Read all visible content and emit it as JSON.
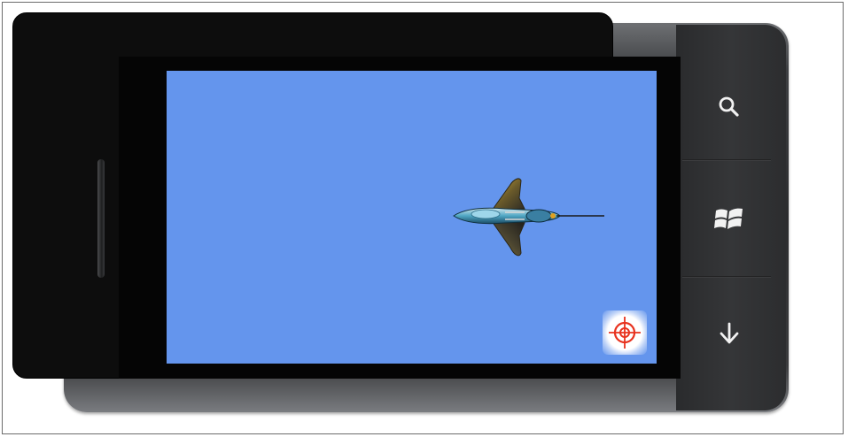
{
  "device": {
    "type": "windows-phone-emulator"
  },
  "hardware_buttons": [
    {
      "id": "search",
      "icon": "search-icon"
    },
    {
      "id": "start",
      "icon": "windows-logo-icon"
    },
    {
      "id": "back",
      "icon": "down-arrow-icon"
    }
  ],
  "game": {
    "background_color": "#6495ed",
    "sprites": [
      "fighter-jet",
      "crosshair-target"
    ]
  },
  "colors": {
    "sky": "#6495ed",
    "crosshair": "#e8321e",
    "device_body": "#2b2c2e"
  }
}
